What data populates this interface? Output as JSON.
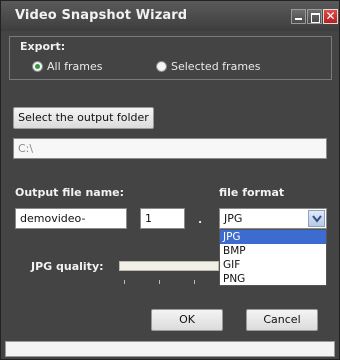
{
  "window": {
    "title": "Video Snapshot Wizard",
    "controls": {
      "minimize_icon": "minimize-icon",
      "maximize_icon": "maximize-icon",
      "close_icon": "close-icon"
    }
  },
  "export": {
    "label": "Export:",
    "options": [
      {
        "label": "All frames",
        "selected": true
      },
      {
        "label": "Selected frames",
        "selected": false
      }
    ]
  },
  "output_folder": {
    "button_label": "Select the output folder",
    "path_value": "C:\\"
  },
  "output_file": {
    "label": "Output file name:",
    "name_value": "demovideo-",
    "number_value": "1",
    "separator": "."
  },
  "file_format": {
    "label": "file format",
    "selected": "JPG",
    "options": [
      "JPG",
      "BMP",
      "GIF",
      "PNG"
    ],
    "highlighted_index": 0
  },
  "jpg_quality": {
    "label": "JPG quality:"
  },
  "actions": {
    "ok_label": "OK",
    "cancel_label": "Cancel"
  },
  "colors": {
    "window_bg": "#444444",
    "selection": "#3c6ccf",
    "close_button": "#c83232",
    "radio_on": "#2f9a3d"
  }
}
